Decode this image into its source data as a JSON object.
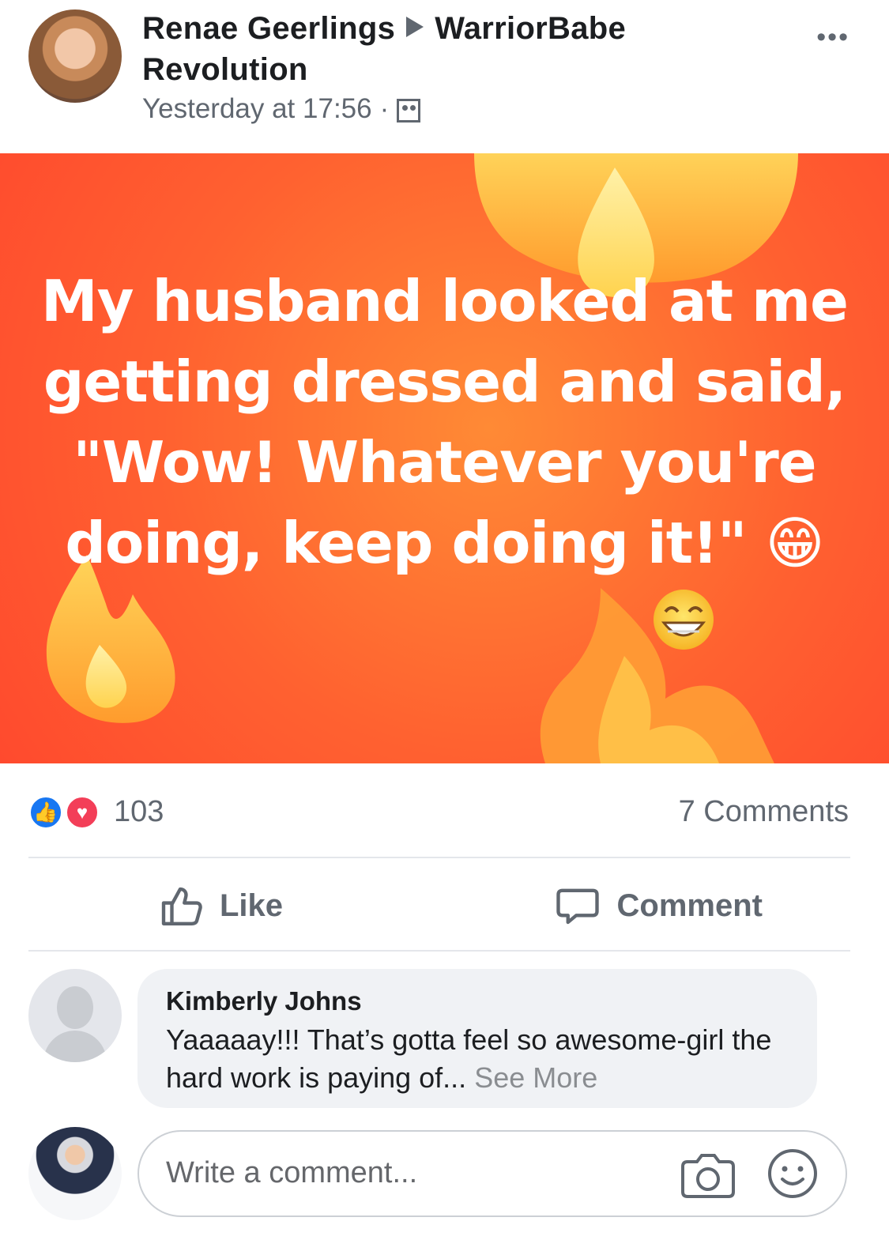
{
  "header": {
    "author": "Renae Geerlings",
    "group_first_line": "WarriorBabe",
    "group_second_line": "Revolution",
    "timestamp": "Yesterday at 17:56",
    "separator": "·",
    "more": "•••"
  },
  "post": {
    "text": "My husband looked at me getting dressed and said, \"Wow! Whatever you're doing, keep doing it!\" 😁"
  },
  "reactions": {
    "count": "103",
    "comments": "7 Comments"
  },
  "actions": {
    "like": "Like",
    "comment": "Comment"
  },
  "comment": {
    "author": "Kimberly Johns",
    "text": "Yaaaaay!!! That’s gotta feel so awesome-girl the hard work is paying of...",
    "see_more": "See More"
  },
  "composer": {
    "placeholder": "Write a comment..."
  }
}
